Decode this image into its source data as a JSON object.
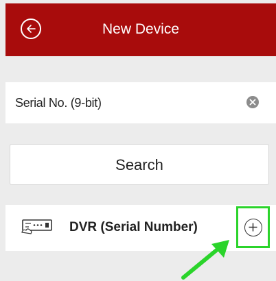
{
  "header": {
    "title": "New Device",
    "back_icon": "back-arrow-icon",
    "background": "#a80c0c"
  },
  "serial": {
    "value": "Serial No. (9-bit)",
    "clear_icon": "clear-icon"
  },
  "search": {
    "label": "Search"
  },
  "device": {
    "label": "DVR (Serial Number)",
    "icon": "dvr-icon",
    "add_icon": "plus-circle-icon",
    "highlight_color": "#2bd42b"
  },
  "annotation": {
    "icon": "pointer-arrow-icon",
    "color": "#2bd42b"
  }
}
